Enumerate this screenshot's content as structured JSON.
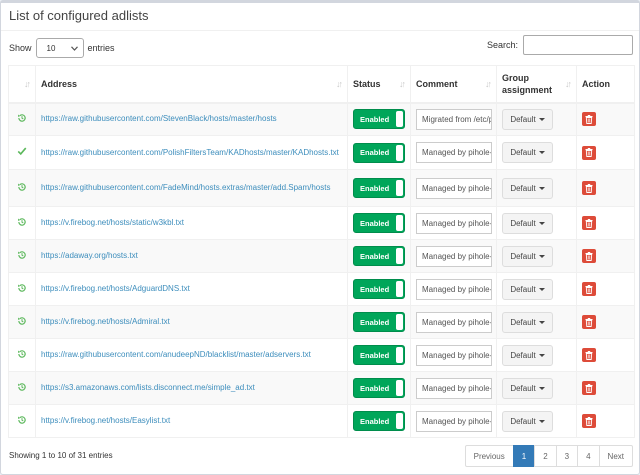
{
  "box": {
    "title": "List of configured adlists"
  },
  "length": {
    "show_label": "Show",
    "value": "10",
    "entries_label": "entries"
  },
  "search": {
    "label": "Search:",
    "value": "",
    "placeholder": ""
  },
  "columns": [
    "",
    "Address",
    "Status",
    "Comment",
    "Group assignment",
    "Action"
  ],
  "rows": [
    {
      "status_icon": "history-icon",
      "address": "https://raw.githubusercontent.com/StevenBlack/hosts/master/hosts",
      "enabled": "Enabled",
      "comment": "Migrated from /etc/pihole/adlists.list",
      "group": "Default"
    },
    {
      "status_icon": "check-icon",
      "address": "https://raw.githubusercontent.com/PolishFiltersTeam/KADhosts/master/KADhosts.txt",
      "enabled": "Enabled",
      "comment": "Managed by pihole-updatelists",
      "group": "Default"
    },
    {
      "status_icon": "history-icon",
      "address": "https://raw.githubusercontent.com/FadeMind/hosts.extras/master/add.Spam/hosts",
      "enabled": "Enabled",
      "comment": "Managed by pihole-updatelists",
      "group": "Default"
    },
    {
      "status_icon": "history-icon",
      "address": "https://v.firebog.net/hosts/static/w3kbl.txt",
      "enabled": "Enabled",
      "comment": "Managed by pihole-updatelists",
      "group": "Default"
    },
    {
      "status_icon": "history-icon",
      "address": "https://adaway.org/hosts.txt",
      "enabled": "Enabled",
      "comment": "Managed by pihole-updatelists",
      "group": "Default"
    },
    {
      "status_icon": "history-icon",
      "address": "https://v.firebog.net/hosts/AdguardDNS.txt",
      "enabled": "Enabled",
      "comment": "Managed by pihole-updatelists",
      "group": "Default"
    },
    {
      "status_icon": "history-icon",
      "address": "https://v.firebog.net/hosts/Admiral.txt",
      "enabled": "Enabled",
      "comment": "Managed by pihole-updatelists",
      "group": "Default"
    },
    {
      "status_icon": "history-icon",
      "address": "https://raw.githubusercontent.com/anudeepND/blacklist/master/adservers.txt",
      "enabled": "Enabled",
      "comment": "Managed by pihole-updatelists",
      "group": "Default"
    },
    {
      "status_icon": "history-icon",
      "address": "https://s3.amazonaws.com/lists.disconnect.me/simple_ad.txt",
      "enabled": "Enabled",
      "comment": "Managed by pihole-updatelists",
      "group": "Default"
    },
    {
      "status_icon": "history-icon",
      "address": "https://v.firebog.net/hosts/Easylist.txt",
      "enabled": "Enabled",
      "comment": "Managed by pihole-updatelists",
      "group": "Default"
    }
  ],
  "footer": {
    "info": "Showing 1 to 10 of 31 entries"
  },
  "pagination": [
    "Previous",
    "1",
    "2",
    "3",
    "4",
    "Next"
  ],
  "pagination_active": "1",
  "colors": {
    "enabled": "#00a65a",
    "delete": "#dd4b39",
    "link": "#3c8dbc",
    "active_page": "#337ab7",
    "status_icon": "#5cb85c"
  }
}
